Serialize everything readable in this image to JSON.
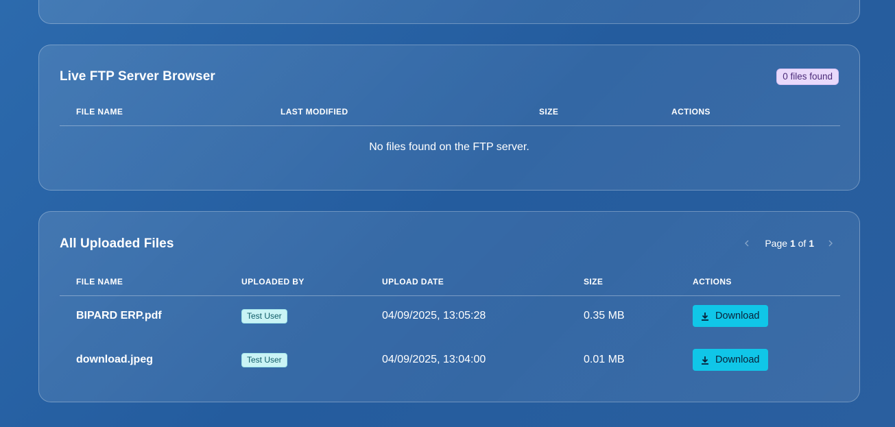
{
  "ftp_browser": {
    "title": "Live FTP Server Browser",
    "count_badge": "0 files found",
    "columns": [
      "File Name",
      "Last Modified",
      "Size",
      "Actions"
    ],
    "empty_message": "No files found on the FTP server."
  },
  "uploads": {
    "title": "All Uploaded Files",
    "pagination": {
      "prefix": "Page",
      "current": "1",
      "separator": "of",
      "total": "1"
    },
    "columns": [
      "File Name",
      "Uploaded By",
      "Upload Date",
      "Size",
      "Actions"
    ],
    "rows": [
      {
        "file_name": "BIPARD ERP.pdf",
        "uploaded_by": "Test User",
        "upload_date": "04/09/2025, 13:05:28",
        "size": "0.35 MB",
        "action_label": "Download"
      },
      {
        "file_name": "download.jpeg",
        "uploaded_by": "Test User",
        "upload_date": "04/09/2025, 13:04:00",
        "size": "0.01 MB",
        "action_label": "Download"
      }
    ]
  },
  "colors": {
    "background": "#2a62a6",
    "badge_purple": "#e9d9fb",
    "badge_cyan": "#c9f3f5",
    "download_button": "#10c6e8"
  },
  "icons": {
    "download": "download-icon",
    "prev_page": "chevron-left-icon",
    "next_page": "chevron-right-icon"
  }
}
